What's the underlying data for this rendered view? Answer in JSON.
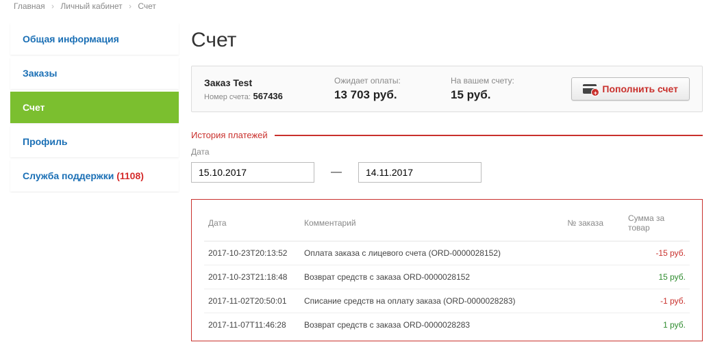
{
  "breadcrumb": {
    "items": [
      "Главная",
      "Личный кабинет",
      "Счет"
    ]
  },
  "sidebar": {
    "items": [
      {
        "label": "Общая информация",
        "active": false
      },
      {
        "label": "Заказы",
        "active": false
      },
      {
        "label": "Счет",
        "active": true
      },
      {
        "label": "Профиль",
        "active": false
      },
      {
        "label": "Служба поддержки",
        "active": false,
        "count": "(1108)"
      }
    ]
  },
  "page": {
    "title": "Счет"
  },
  "summary": {
    "order_title": "Заказ Test",
    "account_label": "Номер счета:",
    "account_number": "567436",
    "await_label": "Ожидает оплаты:",
    "await_amount": "13 703 руб.",
    "balance_label": "На вашем счету:",
    "balance_amount": "15 руб.",
    "topup_label": "Пополнить счет"
  },
  "history": {
    "section_title": "История платежей",
    "date_label": "Дата",
    "date_from": "15.10.2017",
    "date_dash": "—",
    "date_to": "14.11.2017",
    "headers": {
      "date": "Дата",
      "comment": "Комментарий",
      "order": "№ заказа",
      "sum": "Сумма за товар"
    },
    "rows": [
      {
        "date": "2017-10-23T20:13:52",
        "comment": "Оплата заказа с лицевого счета (ORD-0000028152)",
        "order": "",
        "sum": "-15 руб.",
        "neg": true
      },
      {
        "date": "2017-10-23T21:18:48",
        "comment": "Возврат средств с заказа ORD-0000028152",
        "order": "",
        "sum": "15 руб.",
        "neg": false
      },
      {
        "date": "2017-11-02T20:50:01",
        "comment": "Списание средств на оплату заказа (ORD-0000028283)",
        "order": "",
        "sum": "-1 руб.",
        "neg": true
      },
      {
        "date": "2017-11-07T11:46:28",
        "comment": "Возврат средств с заказа ORD-0000028283",
        "order": "",
        "sum": "1 руб.",
        "neg": false
      }
    ]
  }
}
